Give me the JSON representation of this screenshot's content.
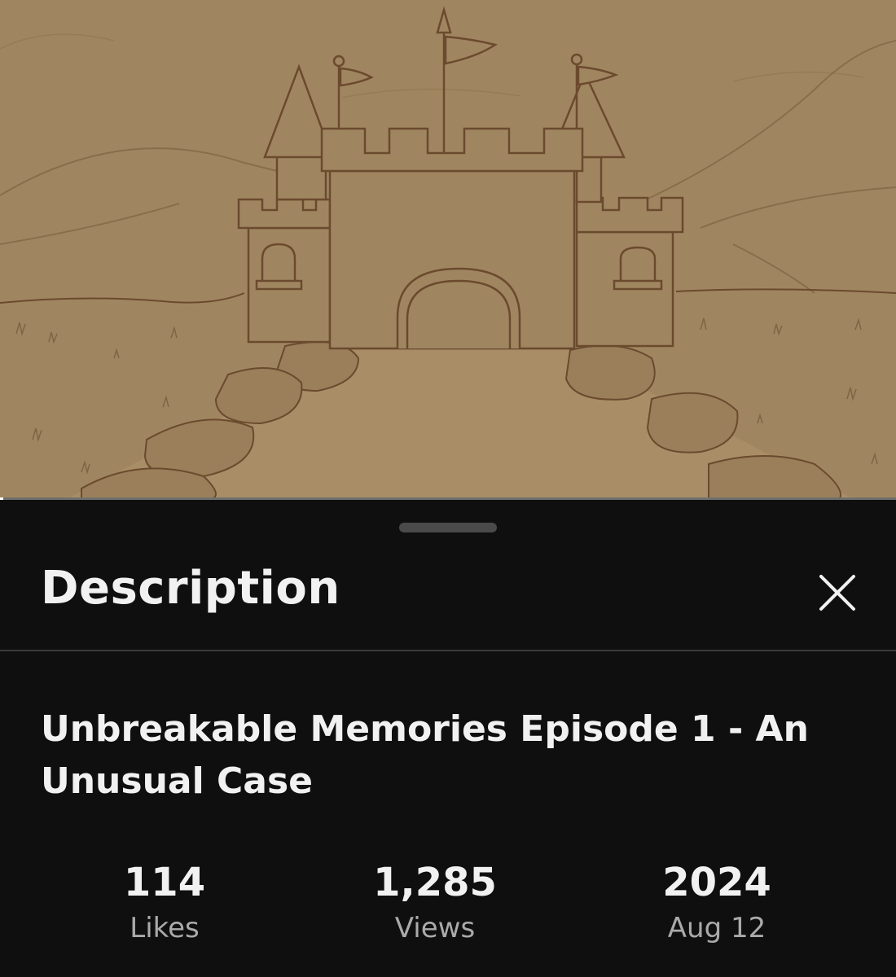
{
  "video": {
    "thumbnail_icon": "castle-illustration",
    "progress_fraction": 0.004,
    "colors": {
      "sepia_background": "#a08660",
      "ink": "#6b4a2e"
    }
  },
  "description_sheet": {
    "title": "Description",
    "close_icon": "close-icon",
    "video_title": "Unbreakable Memories Episode 1 - An Unusual Case",
    "stats": {
      "likes": {
        "value": "114",
        "label": "Likes"
      },
      "views": {
        "value": "1,285",
        "label": "Views"
      },
      "date": {
        "value": "2024",
        "label": "Aug 12"
      }
    }
  },
  "colors": {
    "sheet_background": "#0f0f0f",
    "primary_text": "#f1f1f1",
    "secondary_text": "#aaaaaa"
  }
}
